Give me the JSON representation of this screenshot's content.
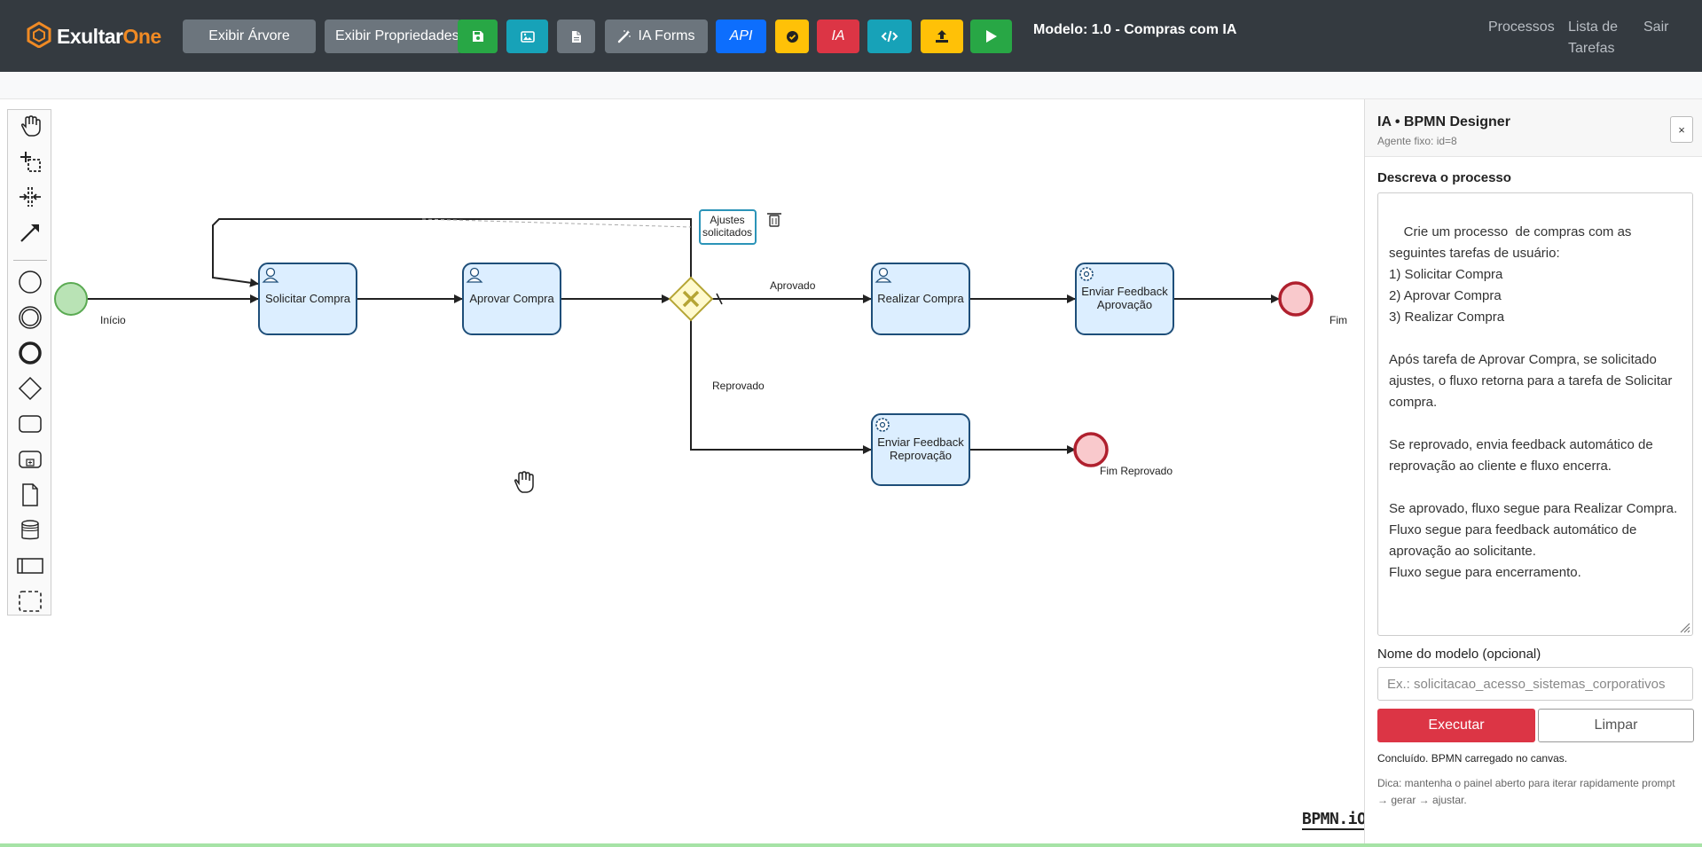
{
  "app": {
    "logo_part1": "Exultar",
    "logo_part2": "One",
    "brand_color": "#f08a24"
  },
  "toolbar": {
    "show_tree": "Exibir Árvore",
    "show_properties": "Exibir Propriedades",
    "ia_forms": "IA Forms",
    "api": "API",
    "ia": "IA",
    "icons": [
      "save-icon",
      "image-icon",
      "file-icon",
      "magic-wand-icon",
      "check-circle-icon",
      "code-icon",
      "upload-icon",
      "play-icon"
    ]
  },
  "model_title": "Modelo: 1.0 - Compras com IA",
  "nav": {
    "processes": "Processos",
    "task_list_line1": "Lista de",
    "task_list_line2": "Tarefas",
    "logout": "Sair"
  },
  "diagram": {
    "start_label": "Início",
    "tasks": {
      "solicitar": "Solicitar Compra",
      "aprovar": "Aprovar Compra",
      "realizar": "Realizar Compra",
      "feedback_aprov_1": "Enviar Feedback",
      "feedback_aprov_2": "Aprovação",
      "feedback_reprov_1": "Enviar Feedback",
      "feedback_reprov_2": "Reprovação"
    },
    "flows": {
      "approved": "Aprovado",
      "rejected": "Reprovado",
      "adjust_1": "Ajustes",
      "adjust_2": "solicitados"
    },
    "end_label": "Fim",
    "end_rejected_label": "Fim Reprovado",
    "watermark": "BPMN.iO"
  },
  "panel": {
    "title": "IA • BPMN Designer",
    "subtitle": "Agente fixo: id=8",
    "close": "×",
    "describe_label": "Descreva o processo",
    "prompt": "Crie um processo  de compras com as seguintes tarefas de usuário:\n1) Solicitar Compra\n2) Aprovar Compra\n3) Realizar Compra\n\nApós tarefa de Aprovar Compra, se solicitado ajustes, o fluxo retorna para a tarefa de Solicitar compra.\n\nSe reprovado, envia feedback automático de reprovação ao cliente e fluxo encerra.\n\nSe aprovado, fluxo segue para Realizar Compra.\nFluxo segue para feedback automático de aprovação ao solicitante.\nFluxo segue para encerramento.",
    "model_name_label": "Nome do modelo (opcional)",
    "model_name_placeholder": "Ex.: solicitacao_acesso_sistemas_corporativos",
    "execute": "Executar",
    "clear": "Limpar",
    "status": "Concluído. BPMN carregado no canvas.",
    "hint": "Dica: mantenha o painel aberto para iterar rapidamente prompt → gerar → ajustar."
  }
}
